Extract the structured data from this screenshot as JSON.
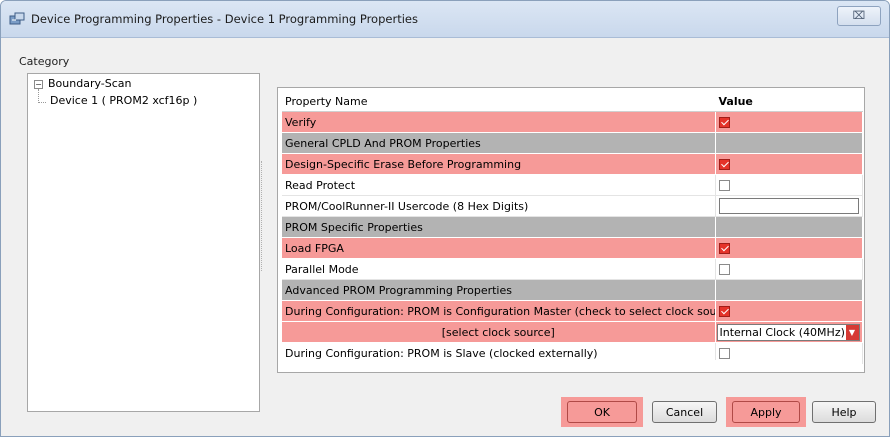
{
  "window": {
    "title": "Device Programming Properties - Device 1 Programming Properties",
    "close_glyph": "⌧"
  },
  "category": {
    "label": "Category",
    "tree": {
      "root": "Boundary-Scan",
      "child": "Device 1 ( PROM2 xcf16p )",
      "expander_glyph": "−"
    }
  },
  "grid": {
    "headers": {
      "name": "Property Name",
      "value": "Value"
    },
    "rows": [
      {
        "name": "Verify",
        "kind": "check",
        "checked": true,
        "style": "hl"
      },
      {
        "name": "General CPLD And PROM Properties",
        "kind": "section",
        "style": "sec"
      },
      {
        "name": "Design-Specific Erase Before Programming",
        "kind": "check",
        "checked": true,
        "style": "hl"
      },
      {
        "name": "Read Protect",
        "kind": "check",
        "checked": false,
        "style": "plain"
      },
      {
        "name": "PROM/CoolRunner-II Usercode (8 Hex Digits)",
        "kind": "text",
        "value": "",
        "style": "plain"
      },
      {
        "name": "PROM Specific Properties",
        "kind": "section",
        "style": "sec"
      },
      {
        "name": "Load FPGA",
        "kind": "check",
        "checked": true,
        "style": "hl"
      },
      {
        "name": "Parallel Mode",
        "kind": "check",
        "checked": false,
        "style": "plain"
      },
      {
        "name": "Advanced PROM Programming Properties",
        "kind": "section",
        "style": "sec"
      },
      {
        "name": "During Configuration: PROM is Configuration Master (check to select clock source)",
        "kind": "check",
        "checked": true,
        "style": "hl"
      },
      {
        "name": "[select clock source]",
        "kind": "combo",
        "value": "Internal Clock (40MHz)",
        "style": "hl",
        "center": true
      },
      {
        "name": "During Configuration: PROM is Slave (clocked externally)",
        "kind": "check",
        "checked": false,
        "style": "plain"
      }
    ]
  },
  "buttons": {
    "ok": "OK",
    "cancel": "Cancel",
    "apply": "Apply",
    "help": "Help"
  },
  "colors": {
    "highlight": "#f69a98",
    "section": "#b3b3b3",
    "checked": "#e5332a"
  }
}
